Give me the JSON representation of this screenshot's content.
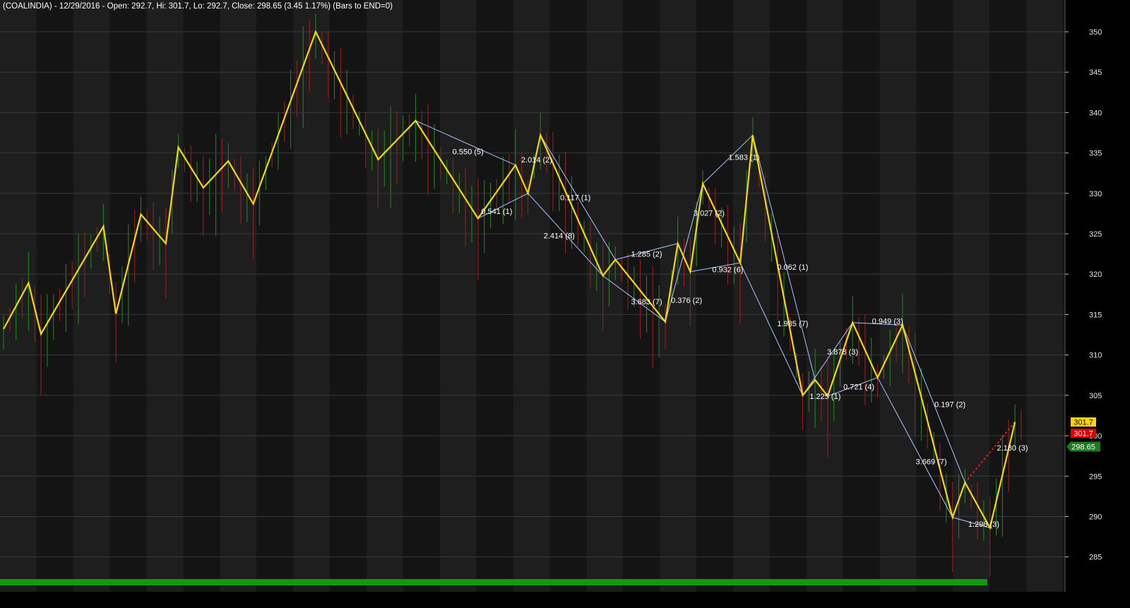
{
  "header": {
    "title": "(COALINDIA) - 12/29/2016 - Open: 292.7, Hi: 301.7, Lo: 292.7, Close: 298.65 (3.45  1.17%)  (Bars to END=0)"
  },
  "colors": {
    "background": "#000000",
    "plot_band_dark": "#141414",
    "plot_band_light": "#1e1e1e",
    "zigzag": "#f5d800",
    "channel": "#a8c8ff",
    "up_bar": "#1f7a1f",
    "down_bar": "#8a1f1f",
    "label_text": "#ffffff",
    "axis_text": "#e6e6e6",
    "bottom_bar": "#119a11",
    "projection": "#ff2020",
    "price_badge_yellow": "#ffd700",
    "price_badge_red": "#e00000",
    "price_badge_green": "#1f7a1f"
  },
  "chart_data": {
    "type": "line",
    "symbol": "COALINDIA",
    "date": "12/29/2016",
    "open": 292.7,
    "high": 301.7,
    "low": 292.7,
    "close": 298.65,
    "change": 3.45,
    "change_pct": 1.17,
    "ylim": [
      281,
      353
    ],
    "grid": true,
    "y_ticks": [
      285,
      290,
      295,
      300,
      305,
      310,
      315,
      320,
      325,
      330,
      335,
      340,
      345,
      350
    ],
    "price_badges": [
      {
        "label": "301.7",
        "value": 301.7,
        "color": "yellow"
      },
      {
        "label": "301.7",
        "value": 300.3,
        "color": "red"
      },
      {
        "label": "298.65",
        "value": 298.65,
        "color": "green"
      }
    ],
    "zigzag": [
      [
        0,
        313.2
      ],
      [
        2,
        318.9
      ],
      [
        3,
        312.6
      ],
      [
        8,
        325.9
      ],
      [
        9,
        315.1
      ],
      [
        11,
        327.4
      ],
      [
        13,
        323.8
      ],
      [
        14,
        335.7
      ],
      [
        16,
        330.7
      ],
      [
        18,
        334.0
      ],
      [
        20,
        328.7
      ],
      [
        25,
        350.0
      ],
      [
        30,
        334.2
      ],
      [
        33,
        339.0
      ],
      [
        38,
        326.9
      ],
      [
        41,
        333.5
      ],
      [
        42,
        330.0
      ],
      [
        43,
        337.2
      ],
      [
        48,
        319.8
      ],
      [
        49,
        321.8
      ],
      [
        53,
        314.1
      ],
      [
        54,
        323.8
      ],
      [
        55,
        320.3
      ],
      [
        56,
        331.2
      ],
      [
        59,
        321.4
      ],
      [
        60,
        337.2
      ],
      [
        64,
        305.0
      ],
      [
        65,
        306.9
      ],
      [
        66,
        304.9
      ],
      [
        68,
        314.0
      ],
      [
        70,
        307.2
      ],
      [
        72,
        313.7
      ],
      [
        76,
        289.9
      ],
      [
        77,
        294.2
      ],
      [
        79,
        288.6
      ],
      [
        81,
        301.7
      ]
    ],
    "channel_segments": [
      [
        [
          33,
          339.0
        ],
        [
          41,
          333.5
        ]
      ],
      [
        [
          38,
          326.9
        ],
        [
          42,
          330.0
        ]
      ],
      [
        [
          42,
          330.0
        ],
        [
          48,
          319.8
        ]
      ],
      [
        [
          43,
          337.2
        ],
        [
          49,
          321.8
        ]
      ],
      [
        [
          48,
          319.8
        ],
        [
          53,
          314.1
        ]
      ],
      [
        [
          49,
          321.8
        ],
        [
          54,
          323.8
        ]
      ],
      [
        [
          53,
          314.1
        ],
        [
          56,
          331.2
        ]
      ],
      [
        [
          55,
          320.3
        ],
        [
          59,
          321.4
        ]
      ],
      [
        [
          56,
          331.2
        ],
        [
          60,
          337.2
        ]
      ],
      [
        [
          60,
          337.2
        ],
        [
          65,
          306.9
        ]
      ],
      [
        [
          59,
          321.4
        ],
        [
          64,
          305.0
        ]
      ],
      [
        [
          64,
          305.0
        ],
        [
          68,
          314.0
        ]
      ],
      [
        [
          66,
          304.9
        ],
        [
          70,
          307.2
        ]
      ],
      [
        [
          68,
          314.0
        ],
        [
          72,
          313.7
        ]
      ],
      [
        [
          70,
          307.2
        ],
        [
          76,
          289.9
        ]
      ],
      [
        [
          72,
          313.7
        ],
        [
          77,
          294.2
        ]
      ],
      [
        [
          76,
          289.9
        ],
        [
          79,
          288.6
        ]
      ]
    ],
    "projection": [
      [
        77,
        294.2
      ],
      [
        81,
        301.7
      ]
    ],
    "annotations": [
      {
        "text": "0.550 (5)",
        "x": 37.2,
        "y": 335.2
      },
      {
        "text": "2.014 (2)",
        "x": 42.7,
        "y": 334.2
      },
      {
        "text": "0.541 (1)",
        "x": 39.5,
        "y": 327.8
      },
      {
        "text": "0.117 (1)",
        "x": 45.8,
        "y": 329.5
      },
      {
        "text": "2.414 (8)",
        "x": 44.5,
        "y": 324.8
      },
      {
        "text": "1.285 (2)",
        "x": 51.5,
        "y": 322.5
      },
      {
        "text": "3.683 (7)",
        "x": 51.5,
        "y": 316.6
      },
      {
        "text": "0.376 (2)",
        "x": 54.7,
        "y": 316.8
      },
      {
        "text": "3.027 (2)",
        "x": 56.5,
        "y": 327.6
      },
      {
        "text": "1.583 (1)",
        "x": 59.3,
        "y": 334.5
      },
      {
        "text": "0.932 (6)",
        "x": 58.0,
        "y": 320.6
      },
      {
        "text": "0.062 (1)",
        "x": 63.2,
        "y": 320.9
      },
      {
        "text": "1.985 (7)",
        "x": 63.2,
        "y": 313.9
      },
      {
        "text": "3.878 (3)",
        "x": 67.2,
        "y": 310.4
      },
      {
        "text": "0.949 (3)",
        "x": 70.8,
        "y": 314.2
      },
      {
        "text": "1.225 (1)",
        "x": 65.8,
        "y": 304.9
      },
      {
        "text": "0.721 (4)",
        "x": 68.5,
        "y": 306.1
      },
      {
        "text": "0.197 (2)",
        "x": 75.8,
        "y": 303.9
      },
      {
        "text": "3.669 (7)",
        "x": 74.3,
        "y": 296.8
      },
      {
        "text": "2.180 (3)",
        "x": 80.8,
        "y": 298.5
      },
      {
        "text": "1.298 (3)",
        "x": 78.5,
        "y": 289.1
      }
    ]
  }
}
